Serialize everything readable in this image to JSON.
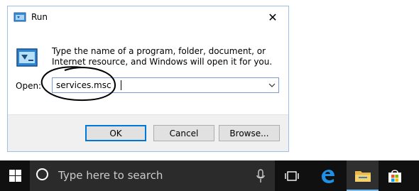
{
  "dialog": {
    "title": "Run",
    "close_glyph": "✕",
    "description": "Type the name of a program, folder, document, or Internet resource, and Windows will open it for you.",
    "open_label": "Open:",
    "open_value": "services.msc",
    "buttons": {
      "ok": "OK",
      "cancel": "Cancel",
      "browse": "Browse..."
    },
    "icons": [
      "run-app-icon",
      "run-large-icon",
      "chevron-down-icon"
    ]
  },
  "taskbar": {
    "search_placeholder": "Type here to search",
    "icons": [
      "windows-logo-icon",
      "cortana-icon",
      "microphone-icon",
      "task-view-icon",
      "edge-icon",
      "file-explorer-icon",
      "store-icon"
    ]
  },
  "colors": {
    "accent": "#0078d7",
    "taskbar": "#101010",
    "searchbox": "#2b2b2b",
    "window_border": "#9cc0e7"
  }
}
